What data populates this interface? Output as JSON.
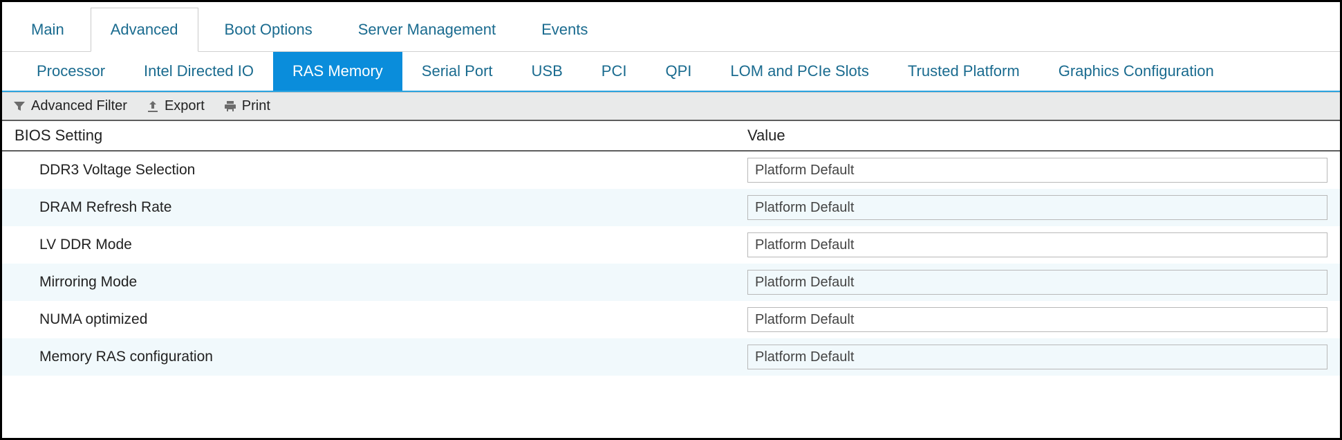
{
  "primary_tabs": {
    "items": [
      {
        "label": "Main"
      },
      {
        "label": "Advanced"
      },
      {
        "label": "Boot Options"
      },
      {
        "label": "Server Management"
      },
      {
        "label": "Events"
      }
    ],
    "active_index": 1
  },
  "secondary_tabs": {
    "items": [
      {
        "label": "Processor"
      },
      {
        "label": "Intel Directed IO"
      },
      {
        "label": "RAS Memory"
      },
      {
        "label": "Serial Port"
      },
      {
        "label": "USB"
      },
      {
        "label": "PCI"
      },
      {
        "label": "QPI"
      },
      {
        "label": "LOM and PCIe Slots"
      },
      {
        "label": "Trusted Platform"
      },
      {
        "label": "Graphics Configuration"
      }
    ],
    "active_index": 2
  },
  "toolbar": {
    "filter_label": "Advanced Filter",
    "export_label": "Export",
    "print_label": "Print"
  },
  "columns": {
    "setting": "BIOS Setting",
    "value": "Value"
  },
  "rows": [
    {
      "setting": "DDR3 Voltage Selection",
      "value": "Platform Default"
    },
    {
      "setting": "DRAM Refresh Rate",
      "value": "Platform Default"
    },
    {
      "setting": "LV DDR Mode",
      "value": "Platform Default"
    },
    {
      "setting": "Mirroring Mode",
      "value": "Platform Default"
    },
    {
      "setting": "NUMA optimized",
      "value": "Platform Default"
    },
    {
      "setting": "Memory RAS configuration",
      "value": "Platform Default"
    }
  ]
}
